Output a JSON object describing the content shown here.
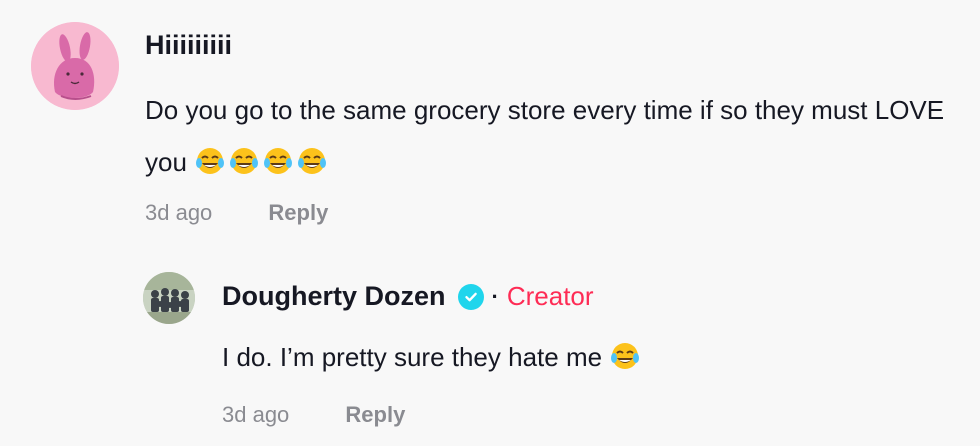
{
  "comment": {
    "username": "Hiiiiiiiii",
    "text": "Do you go to the same grocery store every time if so they must LOVE you",
    "emojis": [
      "face-with-tears-of-joy-icon",
      "face-with-tears-of-joy-icon",
      "face-with-tears-of-joy-icon",
      "face-with-tears-of-joy-icon"
    ],
    "time": "3d ago",
    "reply_label": "Reply"
  },
  "reply": {
    "username": "Dougherty Dozen",
    "verified_icon": "verified-check-icon",
    "separator": "·",
    "badge": "Creator",
    "text": "I do. I’m pretty sure they hate me",
    "emojis": [
      "face-with-tears-of-joy-icon"
    ],
    "time": "3d ago",
    "reply_label": "Reply"
  },
  "colors": {
    "background": "#f8f8f8",
    "text_primary": "#161823",
    "text_secondary": "#8a8b91",
    "creator_badge": "#fe2c55",
    "verified": "#20d5ec"
  }
}
